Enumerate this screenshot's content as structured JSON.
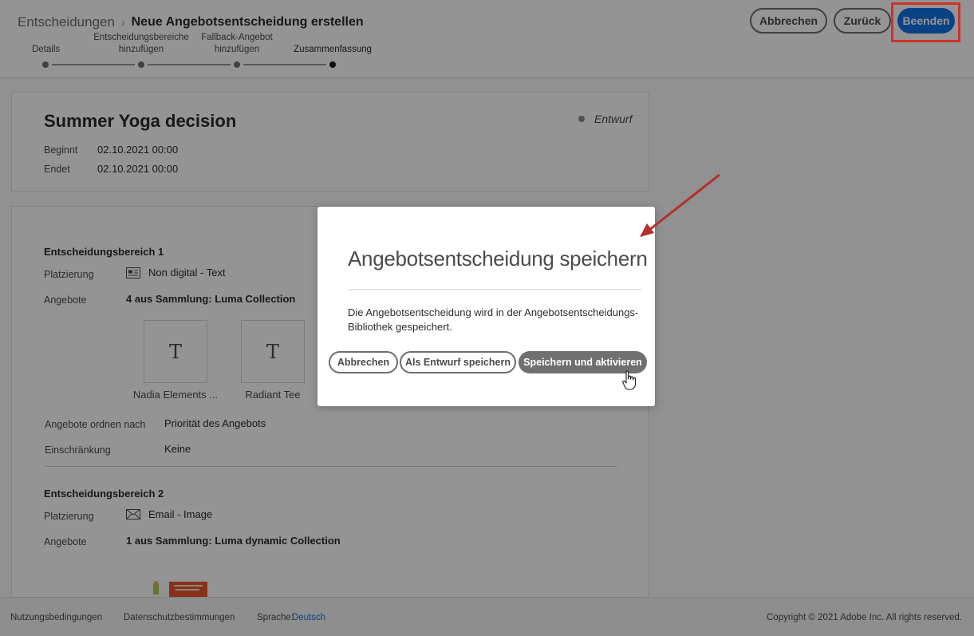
{
  "header": {
    "breadcrumb_root": "Entscheidungen",
    "breadcrumb_separator": "›",
    "breadcrumb_current": "Neue Angebotsentscheidung erstellen",
    "steps": [
      {
        "line1": "",
        "line2": "Details"
      },
      {
        "line1": "Entscheidungsbereiche",
        "line2": "hinzufügen"
      },
      {
        "line1": "Fallback-Angebot",
        "line2": "hinzufügen"
      },
      {
        "line1": "",
        "line2": "Zusammenfassung"
      }
    ],
    "cancel_label": "Abbrechen",
    "back_label": "Zurück",
    "finish_label": "Beenden"
  },
  "summary": {
    "title": "Summer Yoga decision",
    "status": "Entwurf",
    "start_label": "Beginnt",
    "start_value": "02.10.2021 00:00",
    "end_label": "Endet",
    "end_value": "02.10.2021 00:00"
  },
  "scope1": {
    "heading": "Entscheidungsbereich 1",
    "placement_label": "Platzierung",
    "placement_value": "Non digital - Text",
    "offers_label": "Angebote",
    "offers_value": "4 aus Sammlung: Luma Collection",
    "offer_tiles": [
      {
        "glyph": "T",
        "name": "Nadia Elements ..."
      },
      {
        "glyph": "T",
        "name": "Radiant Tee"
      }
    ],
    "order_label": "Angebote ordnen nach",
    "order_value": "Priorität des Angebots",
    "constraint_label": "Einschränkung",
    "constraint_value": "Keine"
  },
  "scope2": {
    "heading": "Entscheidungsbereich 2",
    "placement_label": "Platzierung",
    "placement_value": "Email - Image",
    "offers_label": "Angebote",
    "offers_value": "1 aus Sammlung: Luma dynamic Collection"
  },
  "footer": {
    "terms": "Nutzungsbedingungen",
    "privacy": "Datenschutzbestimmungen",
    "language_label": "Sprache:",
    "language_value": "Deutsch",
    "copyright": "Copyright ©  2021 Adobe Inc.  All rights reserved."
  },
  "dialog": {
    "title": "Angebotsentscheidung speichern",
    "body": "Die Angebotsentscheidung wird in der Angebotsentscheidungs-Bibliothek gespeichert.",
    "cancel_label": "Abbrechen",
    "draft_label": "Als Entwurf speichern",
    "activate_label": "Speichern und aktivieren"
  },
  "colors": {
    "accent": "#1473e6",
    "callout": "#d0312b",
    "dialog_primary": "#707070"
  }
}
